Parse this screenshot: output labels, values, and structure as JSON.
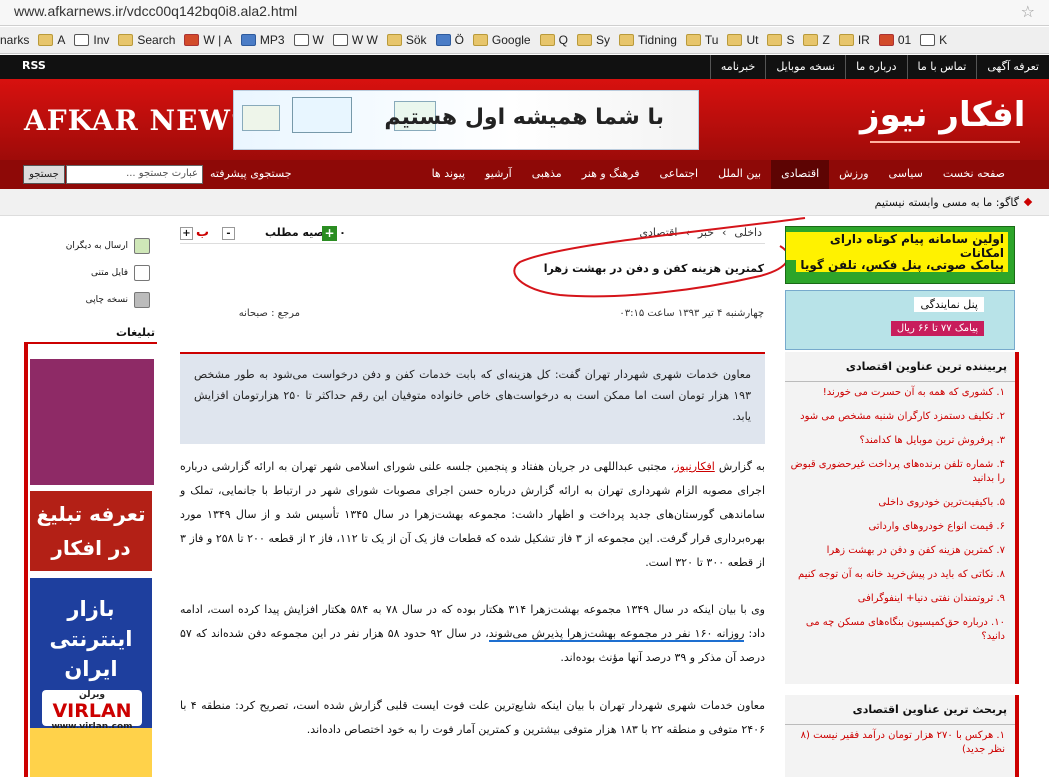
{
  "browser": {
    "url": "www.afkarnews.ir/vdcc00q142bq0i8.ala2.html",
    "bookmarks": [
      "narks",
      "A",
      "Inv",
      "Search",
      "W | A",
      "MP3",
      "W",
      "W W",
      "Sök",
      "Ö",
      "Google",
      "Q",
      "Sy",
      "Tidning",
      "Tu",
      "Ut",
      "S",
      "Z",
      "IR",
      "01",
      "K"
    ]
  },
  "topbar": {
    "links": [
      "تعرفه آگهی",
      "تماس با ما",
      "درباره ما",
      "نسخه موبایل",
      "خبرنامه"
    ],
    "rss": "RSS"
  },
  "header": {
    "logo_en": "AFKAR NEWS",
    "logo_fa": "افکار نیوز",
    "banner_text": "با شما همیشه اول هستیم"
  },
  "nav": {
    "items": [
      "صفحه نخست",
      "سیاسی",
      "ورزش",
      "اقتصادی",
      "بین الملل",
      "اجتماعی",
      "فرهنگ و هنر",
      "مذهبی",
      "آرشیو",
      "پیوند ها"
    ],
    "active_index": 3,
    "advanced_search": "جستجوی پیشرفته",
    "search_placeholder": "عبارت جستجو ...",
    "search_button": "جستجو"
  },
  "ticker": {
    "text": "گاگو: ما به مسی وابسته نیستیم"
  },
  "tools": {
    "send": "ارسال به دیگران",
    "text": "فایل متنی",
    "print": "نسخه چاپی",
    "ads_header": "تبلیغات"
  },
  "ads": {
    "tariff": "تعرفه تبلیغ در افکار نیوز",
    "bazar_title": "بازار اینترنتی ایران",
    "virlan_fa": "ویرلن",
    "virlan_en": "VIRLAN",
    "virlan_url": "www.virlan.com"
  },
  "breadcrumb": [
    "داخلی",
    "خبر",
    "اقتصادی"
  ],
  "article_tools": {
    "recommend": "توصیه مطلب",
    "count": "۰",
    "font_minus": "-",
    "font_plus": "+",
    "font_label": "ب"
  },
  "article": {
    "title": "کمترین هزینه کفن و دفن در بهشت زهرا",
    "date": "چهارشنبه ۴ تیر ۱۳۹۳ ساعت ۰۳:۱۵",
    "source": "مرجع : صبحانه",
    "lead": "معاون خدمات شهری شهردار تهران گفت: کل هزینه‌ای که بابت خدمات کفن و دفن درخواست می‌شود به طور مشخص ۱۹۳ هزار تومان است اما ممکن است به درخواست‌های خاص خانواده متوفیان این رقم حداکثر تا ۲۵۰ هزارتومان افزایش یابد.",
    "p1_prefix": "به گزارش ",
    "p1_link": "افکارنیوز",
    "p1_rest": "، مجتبی عبداللهی در جریان هفتاد و پنجمین جلسه علنی شورای اسلامی شهر تهران به ارائه گزارشی درباره اجرای مصوبه الزام شهرداری تهران به ارائه گزارش درباره حسن اجرای مصوبات شورای شهر در ارتباط با جانمایی، تملک و ساماندهی گورستان‌های جدید پرداخت و اظهار داشت: مجموعه بهشت‌زهرا در سال ۱۳۴۵ تأسیس شد و از سال ۱۳۴۹ مورد بهره‌برداری قرار گرفت. این مجموعه از ۳ فاز تشکیل شده که قطعات فاز یک آن از یک تا ۱۱۲، فاز ۲ از قطعه ۲۰۰ تا ۲۵۸ و فاز ۳ از قطعه ۳۰۰ تا ۳۲۰ است.",
    "p2_a": "وی با بیان اینکه در سال ۱۳۴۹ مجموعه بهشت‌زهرا ۳۱۴ هکتار بوده که در سال ۷۸ به ۵۸۴ هکتار افزایش پیدا کرده است، ادامه داد: ",
    "p2_underlined": "روزانه ۱۶۰ نفر در مجموعه بهشت‌زهرا پذیرش می‌شوند",
    "p2_b": "، در سال ۹۲ حدود ۵۸ هزار نفر در این مجموعه دفن شده‌اند که ۵۷ درصد آن مذکر و ۳۹ درصد آنها مؤنث بوده‌اند.",
    "p3": "معاون خدمات شهری شهردار تهران با بیان اینکه شایع‌ترین علت فوت ایست قلبی گزارش شده است، تصریح کرد: منطقه ۴ با ۲۴۰۶ متوفی و منطقه ۲۲ با ۱۸۳ هزار متوفی بیشترین و کمترین آمار فوت را به خود اختصاص داده‌اند."
  },
  "right_ads": {
    "a1": "اولین سامانه پیام کوتاه دارای امکانات",
    "a2": "پیامک صوتی، پنل فکس، تلفن گویا",
    "b1": "پنل نمایندگی",
    "b2": "پیامک ۷۷ تا ۶۶ ریال"
  },
  "popular": {
    "header": "پربیننده ترین عناوین اقتصادی",
    "items": [
      "۱. کشوری که همه به آن حسرت می خورند!",
      "۲. تکلیف دستمزد کارگران شنبه مشخص می شود",
      "۳. پرفروش ترین موبایل ها کدامند؟",
      "۴. شماره تلفن برنده‌های پرداخت غیرحضوری قبوض را بدانید",
      "۵. باکیفیت‌ترین خودروی داخلی",
      "۶. قیمت انواع خودروهای وارداتی",
      "۷. کمترین هزینه کفن و دفن در بهشت زهرا",
      "۸. نکاتی که باید در پیش‌خرید خانه به آن توجه کنیم",
      "۹. ثروتمندان نفتی دنیا+ اینفوگرافی",
      "۱۰. درباره حق‌کمیسیون بنگاه‌های مسکن چه می دانید؟"
    ]
  },
  "discussed": {
    "header": "پربحث ترین عناوین اقتصادی",
    "items": [
      "۱. هرکس با ۲۷۰ هزار تومان درآمد فقیر نیست (۸ نظر جدید)"
    ]
  }
}
